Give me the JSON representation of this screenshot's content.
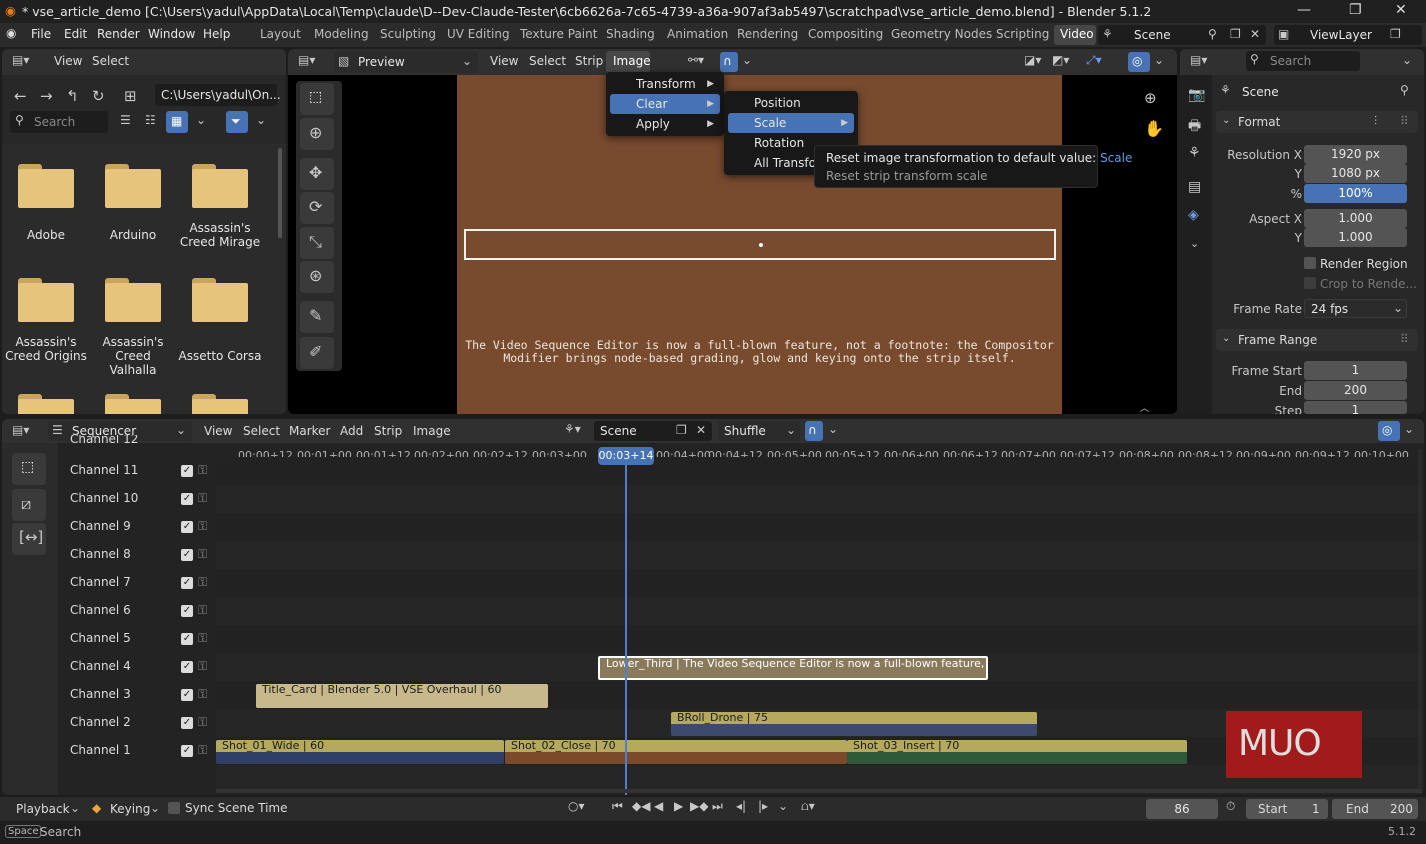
{
  "window": {
    "title": "* vse_article_demo [C:\\Users\\yadul\\AppData\\Local\\Temp\\claude\\D--Dev-Claude-Tester\\6cb6626a-7c65-4739-a36a-907af3ab5497\\scratchpad\\vse_article_demo.blend] - Blender 5.1.2"
  },
  "menubar": {
    "items": [
      "File",
      "Edit",
      "Render",
      "Window",
      "Help"
    ],
    "workspaces": [
      "Layout",
      "Modeling",
      "Sculpting",
      "UV Editing",
      "Texture Paint",
      "Shading",
      "Animation",
      "Rendering",
      "Compositing",
      "Geometry Nodes",
      "Scripting",
      "Video"
    ],
    "scene": "Scene",
    "view_layer": "ViewLayer"
  },
  "file_browser": {
    "menu": [
      "View",
      "Select"
    ],
    "path": "C:\\Users\\yadul\\On...",
    "search_placeholder": "Search",
    "folders": [
      {
        "name": "Adobe"
      },
      {
        "name": "Arduino"
      },
      {
        "name": "Assassin's\nCreed Mirage"
      },
      {
        "name": "Assassin's\nCreed Origins"
      },
      {
        "name": "Assassin's\nCreed Valhalla"
      },
      {
        "name": "Assetto Corsa"
      }
    ]
  },
  "preview": {
    "mode": "Preview",
    "menu": [
      "View",
      "Select",
      "Strip",
      "Image"
    ],
    "caption_line1": "The Video Sequence Editor is now a full-blown feature, not a footnote: the Compositor",
    "caption_line2": "Modifier brings node-based grading, glow and keying onto the strip itself.",
    "bg_color": "#784a2e"
  },
  "image_menu": {
    "items": [
      "Transform",
      "Clear",
      "Apply"
    ]
  },
  "clear_menu": {
    "items": [
      "Position",
      "Scale",
      "Rotation",
      "All Transforms"
    ]
  },
  "tooltip": {
    "line1": "Reset image transformation to default value:",
    "highlight": "Scale",
    "line2": "Reset strip transform scale"
  },
  "properties": {
    "search_placeholder": "Search",
    "scene": "Scene",
    "format_title": "Format",
    "res_x_label": "Resolution X",
    "res_x": "1920 px",
    "res_y_label": "Y",
    "res_y": "1080 px",
    "pct_label": "%",
    "pct": "100%",
    "aspect_x_label": "Aspect X",
    "aspect_x": "1.000",
    "aspect_y_label": "Y",
    "aspect_y": "1.000",
    "render_region": "Render Region",
    "crop": "Crop to Rende...",
    "frame_rate_label": "Frame Rate",
    "frame_rate": "24 fps",
    "frame_range_title": "Frame Range",
    "frame_start_label": "Frame Start",
    "frame_start": "1",
    "end_label": "End",
    "end": "200",
    "step_label": "Step",
    "step": "1"
  },
  "sequencer": {
    "editor": "Sequencer",
    "menu": [
      "View",
      "Select",
      "Marker",
      "Add",
      "Strip",
      "Image"
    ],
    "scene": "Scene",
    "mode": "Shuffle",
    "current_time": "00:03+14",
    "ticks": [
      "00:00+12",
      "00:01+00",
      "00:01+12",
      "00:02+00",
      "00:02+12",
      "00:03+00",
      "00:04+00",
      "00:04+12",
      "00:05+00",
      "00:05+12",
      "00:06+00",
      "00:06+12",
      "00:07+00",
      "00:07+12",
      "00:08+00",
      "00:08+12",
      "00:09+00",
      "00:09+12",
      "00:10+00"
    ],
    "channels": [
      "Channel 12",
      "Channel 11",
      "Channel 10",
      "Channel 9",
      "Channel 8",
      "Channel 7",
      "Channel 6",
      "Channel 5",
      "Channel 4",
      "Channel 3",
      "Channel 2",
      "Channel 1"
    ],
    "strips": [
      {
        "label": "Lower_Third | The Video Sequence Editor is now a full-blown feature, not",
        "color": "#c8b98c"
      },
      {
        "label": "Title_Card | Blender 5.0  |  VSE Overhaul | 60",
        "color": "#c8b98c"
      },
      {
        "label": "BRoll_Drone | 75",
        "color": "#b5a95e"
      },
      {
        "label": "Shot_01_Wide | 60",
        "color": "#b5a95e"
      },
      {
        "label": "Shot_02_Close | 70",
        "color": "#b5a95e"
      },
      {
        "label": "Shot_03_Insert | 70",
        "color": "#b5a95e"
      }
    ],
    "watermark": "MUO"
  },
  "playback": {
    "playback": "Playback",
    "keying": "Keying",
    "sync": "Sync Scene Time",
    "frame": "86",
    "start_label": "Start",
    "start": "1",
    "end_label": "End",
    "end": "200"
  },
  "statusbar": {
    "key": "Space",
    "action": "Search",
    "version": "5.1.2"
  }
}
